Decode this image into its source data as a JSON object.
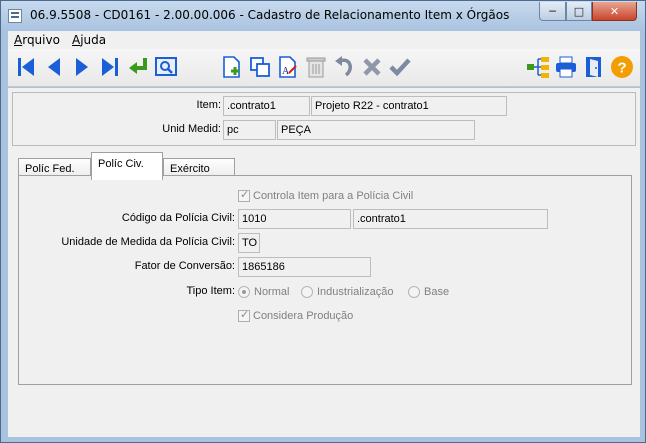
{
  "window": {
    "title": "06.9.5508 - CD0161 - 2.00.00.006 - Cadastro de Relacionamento Item x Órgãos",
    "min_glyph": "─",
    "max_glyph": "□",
    "close_glyph": "✕"
  },
  "menu": {
    "file": {
      "accel": "A",
      "rest": "rquivo"
    },
    "help": {
      "accel": "A",
      "rest": "juda"
    }
  },
  "toolbar": {
    "icons": [
      "first-record-icon",
      "previous-record-icon",
      "next-record-icon",
      "last-record-icon",
      "goto-icon",
      "search-icon",
      "new-document-icon",
      "copy-icon",
      "edit-icon",
      "delete-icon",
      "undo-icon",
      "cancel-icon",
      "confirm-icon",
      "hierarchy-icon",
      "print-icon",
      "exit-icon",
      "help-icon"
    ],
    "colors": {
      "nav_blue": "#1a5fd8",
      "confirm_green": "#3a9b1a",
      "help_orange": "#f29d00"
    }
  },
  "header": {
    "item_label": "Item:",
    "item_code": ".contrato1",
    "item_desc": "Projeto R22 - contrato1",
    "unid_label": "Unid Medid:",
    "unid_code": "pc",
    "unid_desc": "PEÇA"
  },
  "tabs": [
    {
      "label": "Políc Fed."
    },
    {
      "label": "Políc Civ."
    },
    {
      "label": "Exército"
    }
  ],
  "policia_civil": {
    "controla_label": "Controla Item para a Polícia Civil",
    "codigo_label": "Código da Polícia Civil:",
    "codigo_value": "1010",
    "codigo_desc": ".contrato1",
    "unidade_label": "Unidade de Medida da Polícia Civil:",
    "unidade_value": "TO",
    "fator_label": "Fator de Conversão:",
    "fator_value": "1865186",
    "tipo_label": "Tipo Item:",
    "tipo_options": [
      "Normal",
      "Industrialização",
      "Base"
    ],
    "tipo_selected": "Normal",
    "considera_label": "Considera Produção"
  }
}
